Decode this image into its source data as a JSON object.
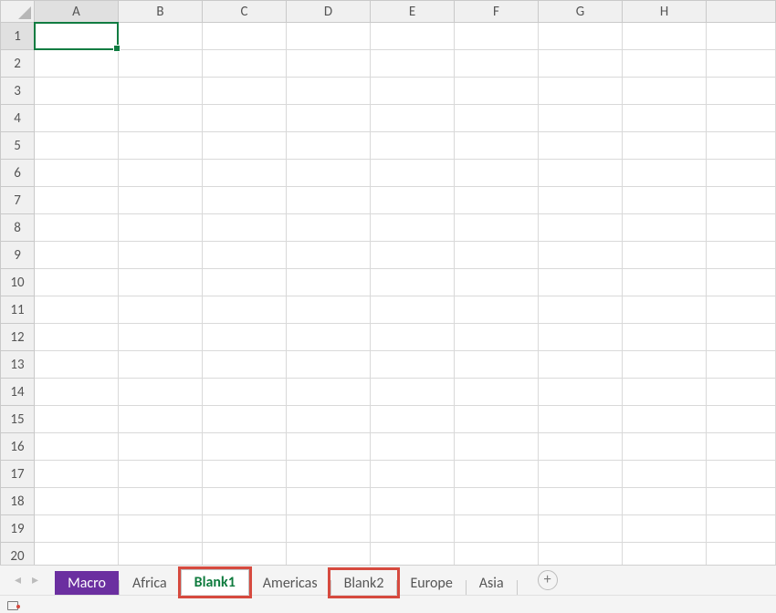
{
  "columns": [
    "A",
    "B",
    "C",
    "D",
    "E",
    "F",
    "G",
    "H"
  ],
  "rows": [
    "1",
    "2",
    "3",
    "4",
    "5",
    "6",
    "7",
    "8",
    "9",
    "10",
    "11",
    "12",
    "13",
    "14",
    "15",
    "16",
    "17",
    "18",
    "19",
    "20"
  ],
  "selected_cell": {
    "col": "A",
    "row": "1"
  },
  "tabs": [
    {
      "label": "Macro",
      "color": "#6b2fa0",
      "active": false,
      "highlight": false
    },
    {
      "label": "Africa",
      "active": false,
      "highlight": false
    },
    {
      "label": "Blank1",
      "active": true,
      "highlight": true
    },
    {
      "label": "Americas",
      "active": false,
      "highlight": false
    },
    {
      "label": "Blank2",
      "active": false,
      "highlight": true
    },
    {
      "label": "Europe",
      "active": false,
      "highlight": false
    },
    {
      "label": "Asia",
      "active": false,
      "highlight": false
    }
  ],
  "nav": {
    "prev": "◂",
    "next": "▸"
  },
  "add_sheet_label": "+"
}
